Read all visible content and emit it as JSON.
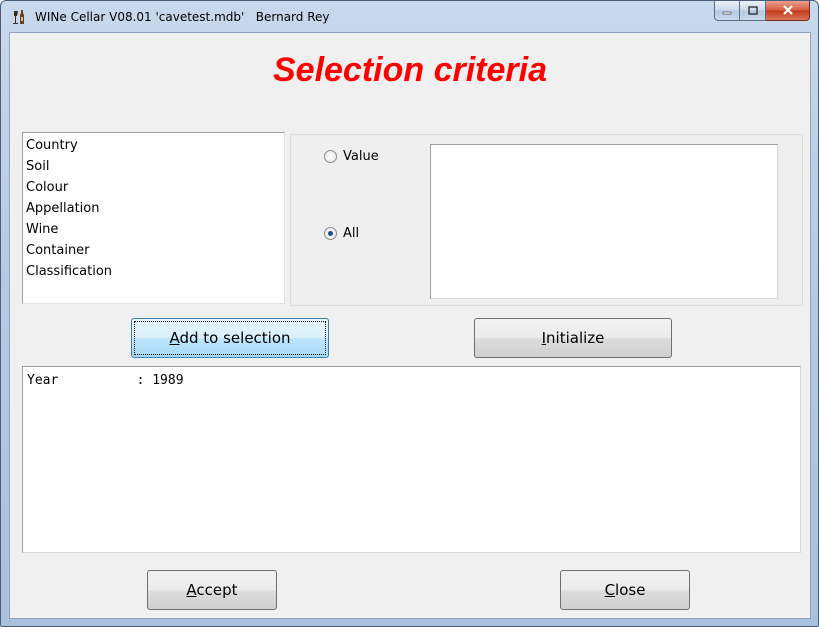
{
  "window": {
    "title": "WINe Cellar V08.01 'cavetest.mdb'   Bernard Rey",
    "app_icon": "wine-icon",
    "buttons": {
      "minimize": "minimize-icon",
      "maximize": "maximize-icon",
      "close": "close-icon"
    }
  },
  "heading": "Selection criteria",
  "criteria_list": [
    "Country",
    "Soil",
    "Colour",
    "Appellation",
    "Wine",
    "Container",
    "Classification"
  ],
  "radio": {
    "value_label": "Value",
    "all_label": "All",
    "selected": "All"
  },
  "buttons": {
    "add_to_selection": {
      "accel": "A",
      "rest": "dd to selection"
    },
    "initialize": {
      "accel": "I",
      "rest": "nitialize"
    },
    "accept": {
      "accel": "A",
      "rest": "ccept"
    },
    "close": {
      "accel": "C",
      "rest": "lose"
    }
  },
  "selection_lines": [
    "Year          : 1989"
  ],
  "colors": {
    "heading": "#ff0000",
    "client_bg": "#f0f0f0"
  }
}
